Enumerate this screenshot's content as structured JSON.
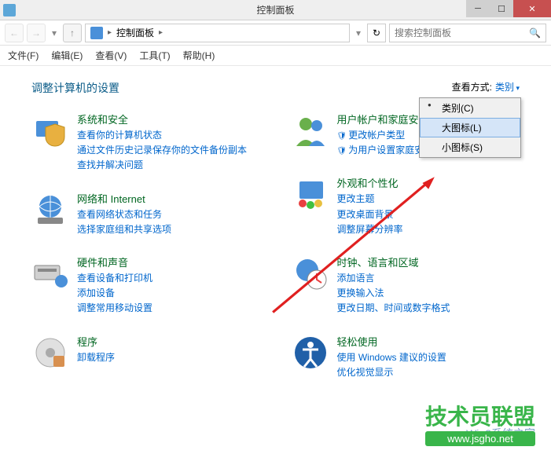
{
  "window": {
    "title": "控制面板"
  },
  "breadcrumb": {
    "current": "控制面板"
  },
  "search": {
    "placeholder": "搜索控制面板"
  },
  "menu": {
    "file": "文件(F)",
    "edit": "编辑(E)",
    "view": "查看(V)",
    "tools": "工具(T)",
    "help": "帮助(H)"
  },
  "heading": "调整计算机的设置",
  "view_by": {
    "label": "查看方式:",
    "value": "类别"
  },
  "dropdown": {
    "items": [
      {
        "label": "类别(C)",
        "checked": true,
        "selected": false
      },
      {
        "label": "大图标(L)",
        "checked": false,
        "selected": true
      },
      {
        "label": "小图标(S)",
        "checked": false,
        "selected": false
      }
    ]
  },
  "categories": {
    "left": [
      {
        "title": "系统和安全",
        "links": [
          "查看你的计算机状态",
          "通过文件历史记录保存你的文件备份副本",
          "查找并解决问题"
        ],
        "icon": "shield"
      },
      {
        "title": "网络和 Internet",
        "links": [
          "查看网络状态和任务",
          "选择家庭组和共享选项"
        ],
        "icon": "globe"
      },
      {
        "title": "硬件和声音",
        "links": [
          "查看设备和打印机",
          "添加设备",
          "调整常用移动设置"
        ],
        "icon": "printer"
      },
      {
        "title": "程序",
        "links": [
          "卸载程序"
        ],
        "icon": "disc"
      }
    ],
    "right": [
      {
        "title": "用户帐户和家庭安全",
        "links": [
          "更改帐户类型",
          "为用户设置家庭安全"
        ],
        "shields": [
          1,
          1
        ],
        "icon": "users"
      },
      {
        "title": "外观和个性化",
        "links": [
          "更改主题",
          "更改桌面背景",
          "调整屏幕分辨率"
        ],
        "icon": "appearance"
      },
      {
        "title": "时钟、语言和区域",
        "links": [
          "添加语言",
          "更换输入法",
          "更改日期、时间或数字格式"
        ],
        "icon": "clock"
      },
      {
        "title": "轻松使用",
        "links": [
          "使用 Windows 建议的设置",
          "优化视觉显示"
        ],
        "icon": "ease"
      }
    ]
  },
  "watermark": {
    "main": "技术员联盟",
    "sub": "www.jsgho.net",
    "side": "Win8系统之家"
  }
}
